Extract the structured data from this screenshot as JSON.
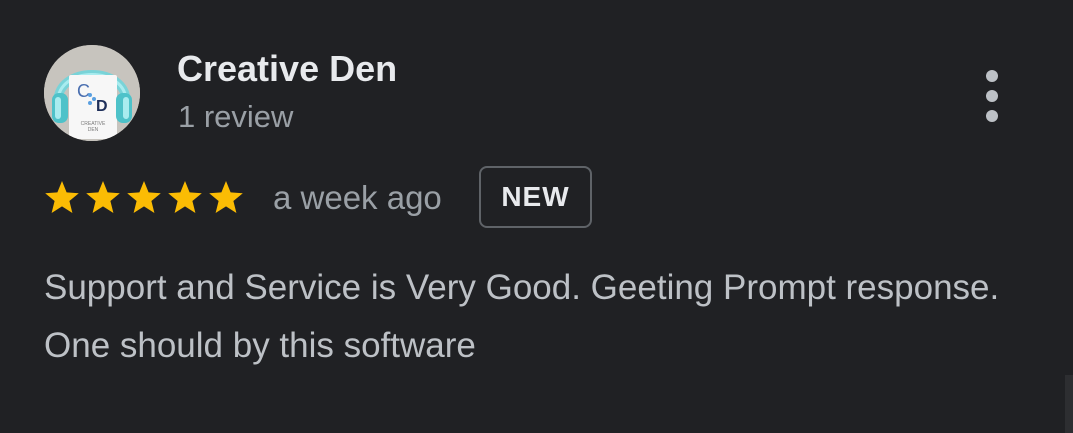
{
  "review": {
    "author": {
      "name": "Creative Den",
      "review_count": "1 review",
      "avatar": {
        "icon": "headphones-logo-icon",
        "logo_letters": [
          "C",
          "D"
        ],
        "logo_caption": [
          "CREATIVE",
          "DEN"
        ]
      }
    },
    "rating": {
      "stars": 5,
      "max_stars": 5,
      "star_icon": "star-icon",
      "star_color": "#fbbc04"
    },
    "time": "a week ago",
    "badge": "NEW",
    "text": "Support and Service is Very Good. Geeting Prompt response. One should by this software",
    "more_icon": "more-vertical-icon"
  },
  "colors": {
    "background": "#202124",
    "primary_text": "#e8eaed",
    "secondary_text": "#9aa0a6",
    "body_text": "#bdc1c6",
    "badge_border": "#5f6368"
  }
}
